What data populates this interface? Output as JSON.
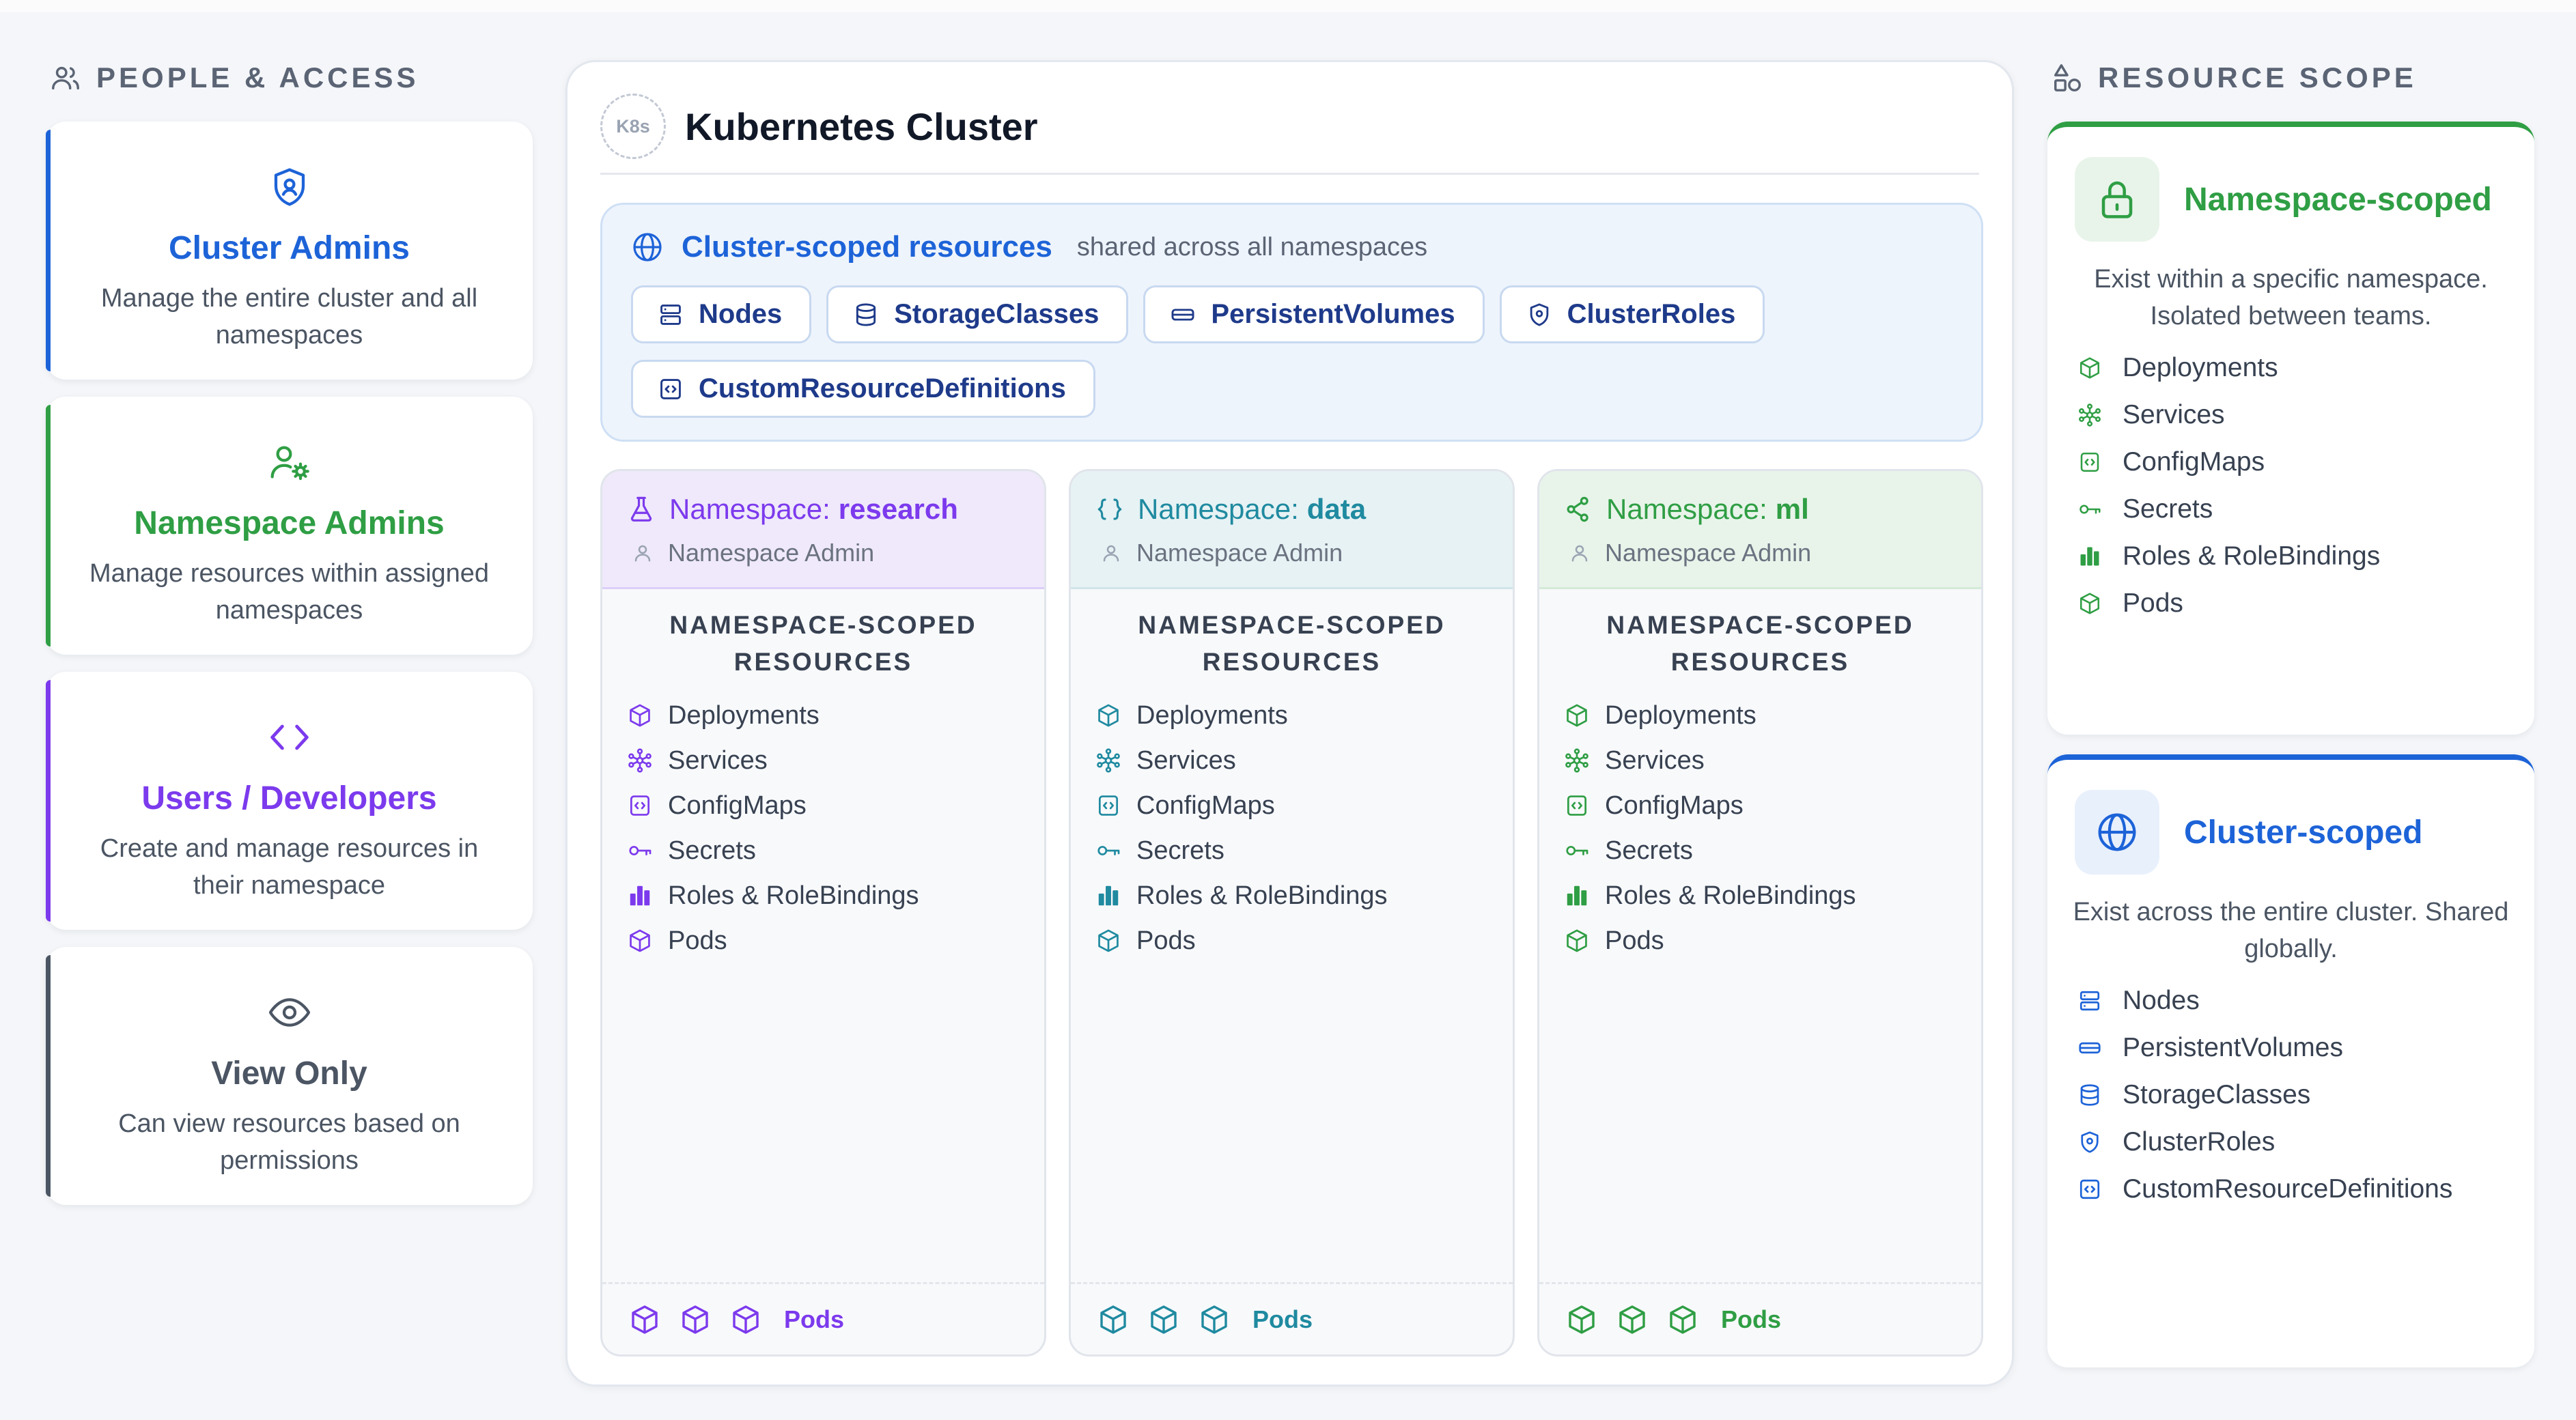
{
  "colors": {
    "blue": "#1d63d8",
    "green": "#2f9e44",
    "purple": "#7c3aed",
    "slate": "#4b5563",
    "teal": "#1f8aa0"
  },
  "people": {
    "header": "PEOPLE & ACCESS",
    "header_icon": "users-icon",
    "cards": [
      {
        "title": "Cluster Admins",
        "desc": "Manage the entire cluster and all namespaces",
        "icon": "shield-icon"
      },
      {
        "title": "Namespace Admins",
        "desc": "Manage resources within assigned namespaces",
        "icon": "user-gear-icon"
      },
      {
        "title": "Users / Developers",
        "desc": "Create and manage resources in their namespace",
        "icon": "code-icon"
      },
      {
        "title": "View Only",
        "desc": "Can view resources based on permissions",
        "icon": "eye-icon"
      }
    ]
  },
  "cluster": {
    "badge": "K8s",
    "title": "Kubernetes Cluster",
    "scoped_title": "Cluster-scoped resources",
    "scoped_subtitle": "shared across all namespaces",
    "chips": [
      "Nodes",
      "StorageClasses",
      "PersistentVolumes",
      "ClusterRoles",
      "CustomResourceDefinitions"
    ]
  },
  "namespaces": [
    {
      "prefix": "Namespace:",
      "name": "research",
      "admin": "Namespace Admin",
      "icon": "flask-icon",
      "res_title": "NAMESPACE-SCOPED RESOURCES",
      "items": [
        "Deployments",
        "Services",
        "ConfigMaps",
        "Secrets",
        "Roles & RoleBindings",
        "Pods"
      ],
      "pods_label": "Pods"
    },
    {
      "prefix": "Namespace:",
      "name": "data",
      "admin": "Namespace Admin",
      "icon": "code-braces-icon",
      "res_title": "NAMESPACE-SCOPED RESOURCES",
      "items": [
        "Deployments",
        "Services",
        "ConfigMaps",
        "Secrets",
        "Roles & RoleBindings",
        "Pods"
      ],
      "pods_label": "Pods"
    },
    {
      "prefix": "Namespace:",
      "name": "ml",
      "admin": "Namespace Admin",
      "icon": "share-icon",
      "res_title": "NAMESPACE-SCOPED RESOURCES",
      "items": [
        "Deployments",
        "Services",
        "ConfigMaps",
        "Secrets",
        "Roles & RoleBindings",
        "Pods"
      ],
      "pods_label": "Pods"
    }
  ],
  "scope": {
    "header": "RESOURCE SCOPE",
    "header_icon": "shapes-icon",
    "namespace_scoped": {
      "title": "Namespace-scoped",
      "desc": "Exist within a specific namespace. Isolated between teams.",
      "icon": "lock-icon",
      "items": [
        "Deployments",
        "Services",
        "ConfigMaps",
        "Secrets",
        "Roles & RoleBindings",
        "Pods"
      ]
    },
    "cluster_scoped": {
      "title": "Cluster-scoped",
      "desc": "Exist across the entire cluster. Shared globally.",
      "icon": "globe-icon",
      "items": [
        "Nodes",
        "PersistentVolumes",
        "StorageClasses",
        "ClusterRoles",
        "CustomResourceDefinitions"
      ]
    }
  }
}
